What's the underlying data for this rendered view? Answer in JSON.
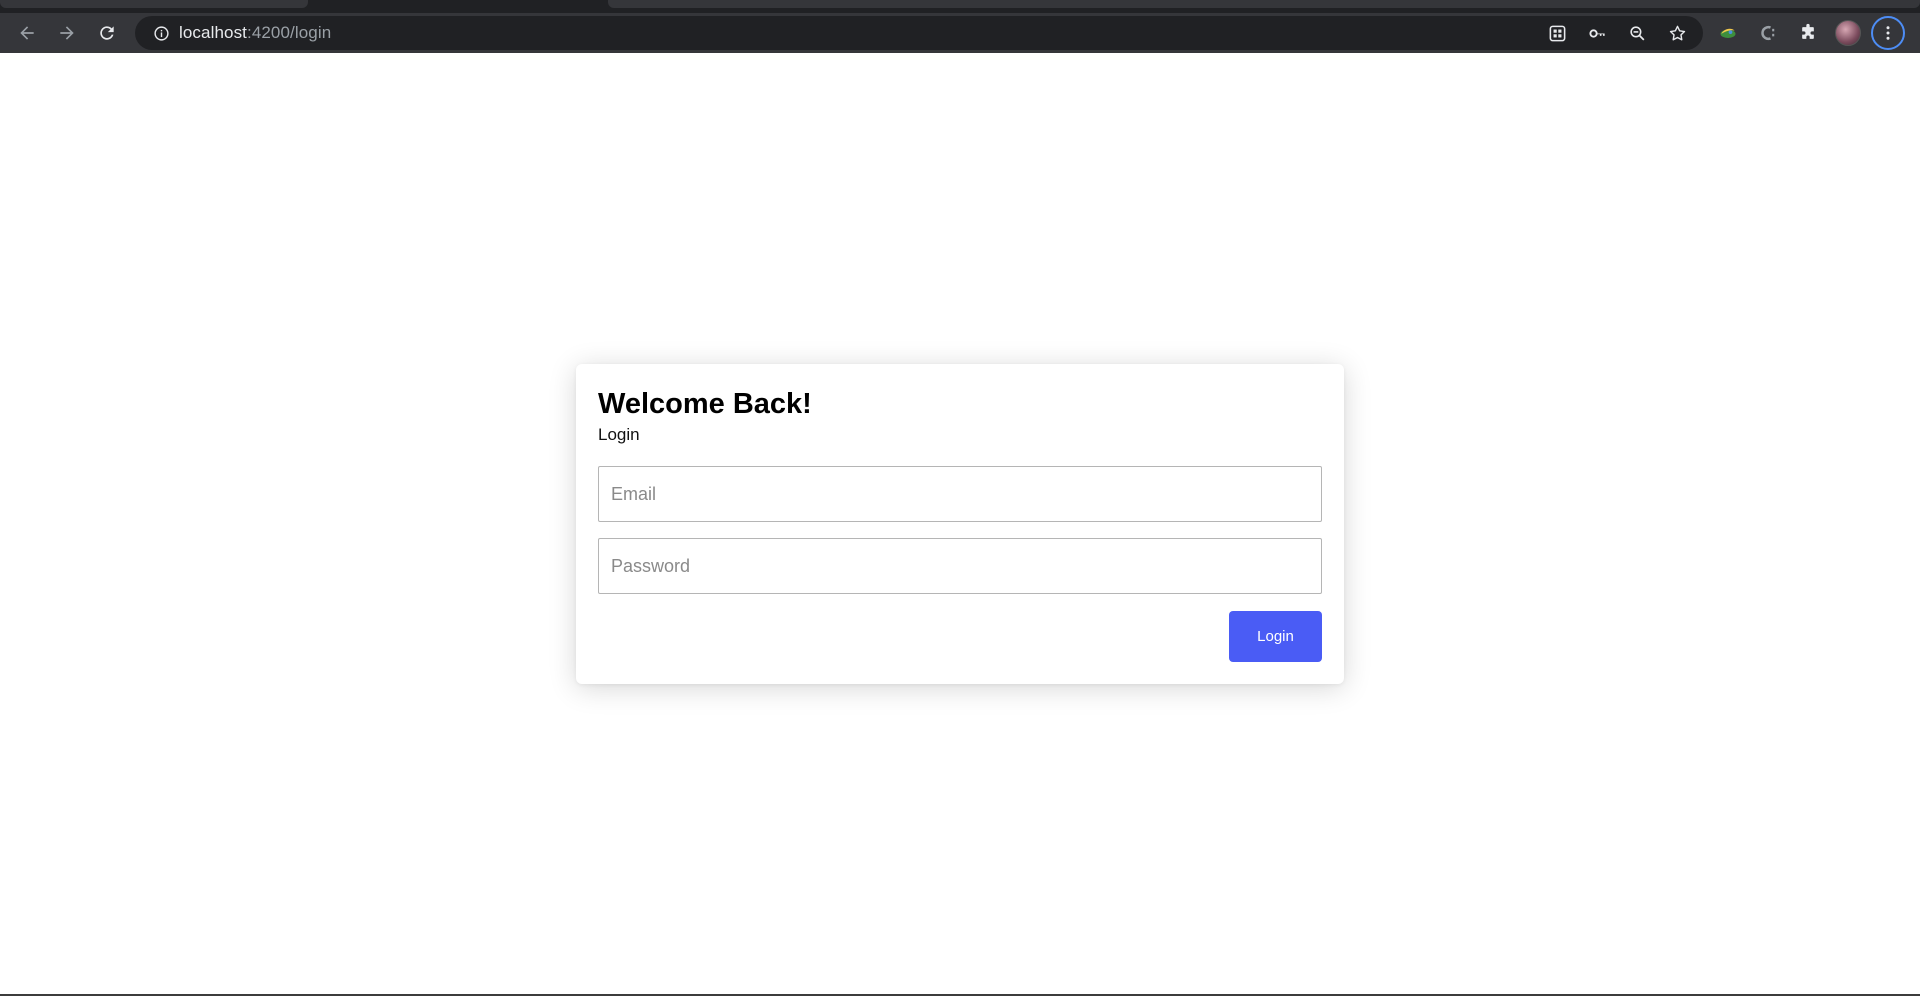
{
  "browser": {
    "url_host": "localhost",
    "url_path": ":4200/login",
    "icons": {
      "back": "arrow-left-icon",
      "forward": "arrow-right-icon",
      "reload": "reload-icon",
      "info": "info-icon",
      "install": "app-install-icon",
      "password": "key-icon",
      "zoom": "zoom-out-icon",
      "bookmark": "star-icon",
      "extensions": "puzzle-icon",
      "menu": "kebab-menu-icon"
    },
    "accent_color": "#4d8df5"
  },
  "login_card": {
    "title": "Welcome Back!",
    "subtitle": "Login",
    "email_placeholder": "Email",
    "password_placeholder": "Password",
    "submit_label": "Login",
    "button_color": "#4a5cf5"
  }
}
